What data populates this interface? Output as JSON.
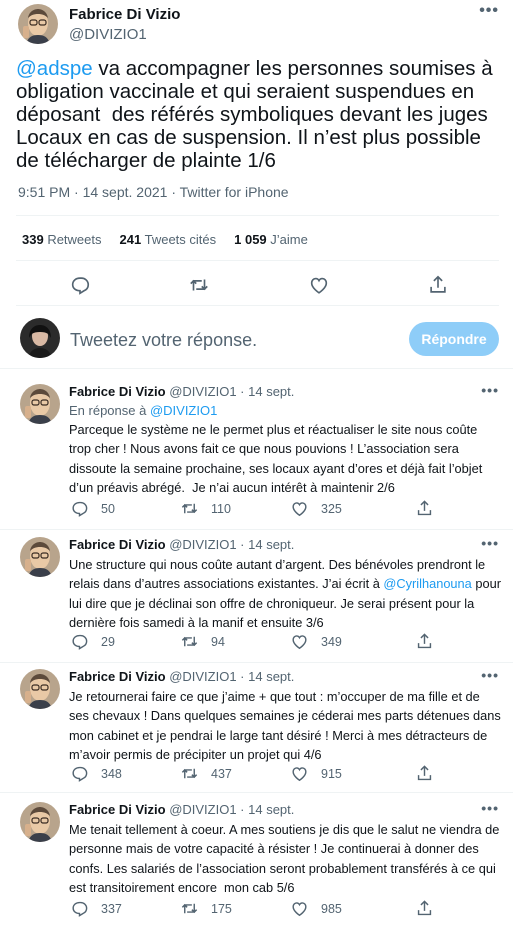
{
  "main_tweet": {
    "author_name": "Fabrice Di Vizio",
    "author_handle": "@DIVIZIO1",
    "more_label": "•••",
    "text_mention": "@adspe",
    "text_rest": " va accompagner les personnes soumises à obligation vaccinale et qui seraient suspendues en déposant  des référés symboliques devant les juges Locaux en cas de suspension. Il n’est plus possible de télécharger de plainte 1/6",
    "meta": "9:51 PM · 14 sept. 2021 · Twitter for iPhone"
  },
  "stats": {
    "retweets_count": "339",
    "retweets_label": " Retweets",
    "quotes_count": "241",
    "quotes_label": " Tweets cités",
    "likes_count": "1 059",
    "likes_label": " J’aime"
  },
  "composer": {
    "placeholder": "Tweetez votre réponse.",
    "button_label": "Répondre"
  },
  "replies": [
    {
      "name": "Fabrice Di Vizio",
      "meta": " @DIVIZIO1 · 14 sept.",
      "in_reply_prefix": "En réponse à ",
      "in_reply_handle": "@DIVIZIO1",
      "text": "Parceque le système ne le permet plus et réactualiser le site nous coûte trop cher ! Nous avons fait ce que nous pouvions ! L’association sera dissoute la semaine prochaine, ses locaux ayant d’ores et déjà fait l’objet d’un préavis abrégé.  Je n’ai aucun intérêt à maintenir 2/6",
      "replies_count": "50",
      "retweets_count": "110",
      "likes_count": "325"
    },
    {
      "name": "Fabrice Di Vizio",
      "meta": " @DIVIZIO1 · 14 sept.",
      "text_before": "Une structure qui nous coûte autant d’argent. Des bénévoles prendront le relais dans d’autres associations existantes. J’ai écrit à ",
      "text_mention": "@Cyrilhanouna",
      "text_after": " pour lui dire que je déclinai son offre de chroniqueur. Je serai présent pour la dernière fois samedi à la manif et ensuite 3/6",
      "replies_count": "29",
      "retweets_count": "94",
      "likes_count": "349"
    },
    {
      "name": "Fabrice Di Vizio",
      "meta": " @DIVIZIO1 · 14 sept.",
      "text": "Je retournerai faire ce que j’aime + que tout : m’occuper de ma fille et de ses chevaux ! Dans quelques semaines je céderai mes parts détenues dans mon cabinet et je pendrai le large tant désiré ! Merci à mes détracteurs de m’avoir permis de précipiter un projet qui 4/6",
      "replies_count": "348",
      "retweets_count": "437",
      "likes_count": "915"
    },
    {
      "name": "Fabrice Di Vizio",
      "meta": " @DIVIZIO1 · 14 sept.",
      "text": "Me tenait tellement à coeur. A mes soutiens je dis que le salut ne viendra de personne mais de votre capacité à résister ! Je continuerai à donner des confs. Les salariés de l’association seront probablement transférés à ce qui est transitoirement encore  mon cab 5/6",
      "replies_count": "337",
      "retweets_count": "175",
      "likes_count": "985"
    }
  ],
  "icons": {
    "reply": "reply-icon",
    "retweet": "retweet-icon",
    "like": "heart-icon",
    "share": "share-icon",
    "more": "more-icon"
  },
  "colors": {
    "accent": "#1d9bf0",
    "button_disabled": "#8ecdf8",
    "secondary_text": "#536471",
    "primary_text": "#0f1419",
    "divider": "#eff3f4"
  }
}
